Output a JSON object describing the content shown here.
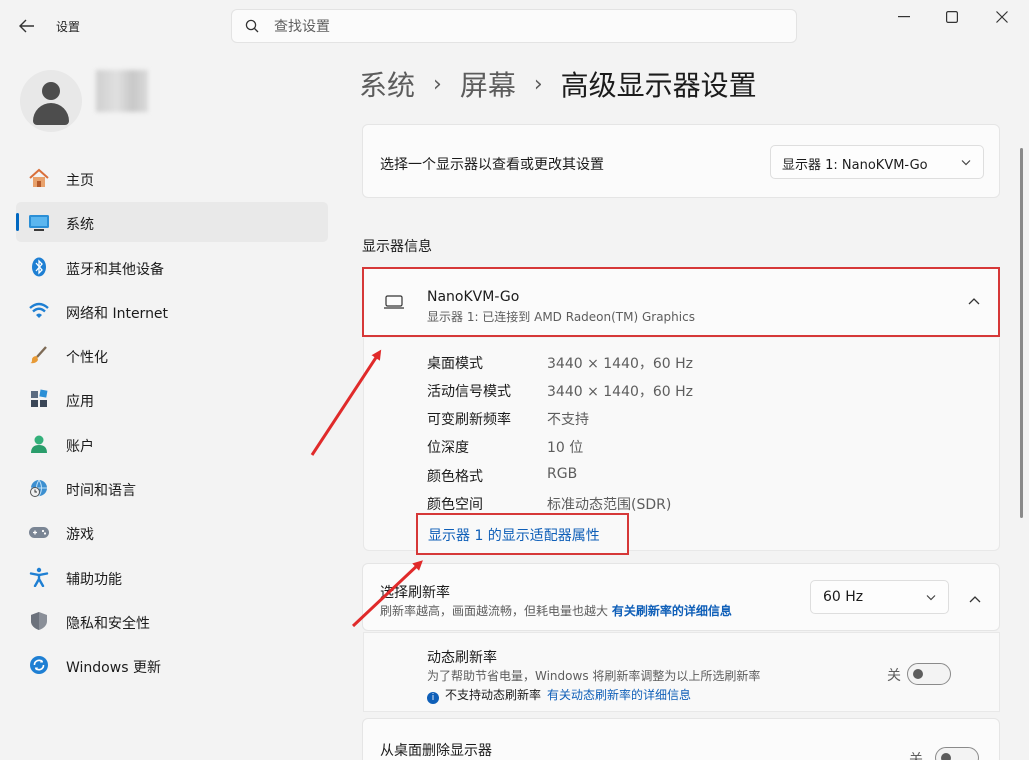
{
  "window": {
    "back_icon": "back-arrow-icon",
    "title": "设置",
    "controls": [
      "minimize-icon",
      "maximize-icon",
      "close-icon"
    ]
  },
  "search": {
    "placeholder": "查找设置",
    "value": ""
  },
  "sidebar": {
    "items": [
      {
        "label": "主页",
        "icon": "home-icon",
        "active": false
      },
      {
        "label": "系统",
        "icon": "system-display-icon",
        "active": true
      },
      {
        "label": "蓝牙和其他设备",
        "icon": "bluetooth-icon",
        "active": false
      },
      {
        "label": "网络和 Internet",
        "icon": "wifi-icon",
        "active": false
      },
      {
        "label": "个性化",
        "icon": "paintbrush-icon",
        "active": false
      },
      {
        "label": "应用",
        "icon": "apps-icon",
        "active": false
      },
      {
        "label": "账户",
        "icon": "account-icon",
        "active": false
      },
      {
        "label": "时间和语言",
        "icon": "globe-clock-icon",
        "active": false
      },
      {
        "label": "游戏",
        "icon": "gamepad-icon",
        "active": false
      },
      {
        "label": "辅助功能",
        "icon": "accessibility-icon",
        "active": false
      },
      {
        "label": "隐私和安全性",
        "icon": "shield-icon",
        "active": false
      },
      {
        "label": "Windows 更新",
        "icon": "update-icon",
        "active": false
      }
    ]
  },
  "breadcrumb": {
    "items": [
      "系统",
      "屏幕"
    ],
    "separator": "›",
    "current": "高级显示器设置"
  },
  "display_select": {
    "label": "选择一个显示器以查看或更改其设置",
    "value": "显示器 1: NanoKVM-Go"
  },
  "display_info": {
    "section_title": "显示器信息",
    "name": "NanoKVM-Go",
    "subtitle": "显示器 1: 已连接到 AMD Radeon(TM) Graphics",
    "rows": [
      {
        "key": "桌面模式",
        "value": "3440 × 1440，60 Hz"
      },
      {
        "key": "活动信号模式",
        "value": "3440 × 1440，60 Hz"
      },
      {
        "key": "可变刷新频率",
        "value": "不支持"
      },
      {
        "key": "位深度",
        "value": "10 位"
      },
      {
        "key": "颜色格式",
        "value": "RGB"
      },
      {
        "key": "颜色空间",
        "value": "标准动态范围(SDR)"
      }
    ],
    "adapter_link": "显示器 1 的显示适配器属性"
  },
  "refresh_rate": {
    "title": "选择刷新率",
    "description": "刷新率越高，画面越流畅，但耗电量也越大",
    "link": "有关刷新率的详细信息",
    "value": "60 Hz"
  },
  "dynamic_refresh": {
    "title": "动态刷新率",
    "description": "为了帮助节省电量，Windows 将刷新率调整为以上所选刷新率",
    "note": "不支持动态刷新率",
    "note_link": "有关动态刷新率的详细信息",
    "toggle_label": "关",
    "enabled": false
  },
  "remove_display": {
    "title": "从桌面删除显示器",
    "toggle_label": "关",
    "enabled": false
  },
  "colors": {
    "accent": "#0067c0",
    "link": "#0f5fb8",
    "highlight_box": "#d63838",
    "arrow": "#e02a2a"
  }
}
